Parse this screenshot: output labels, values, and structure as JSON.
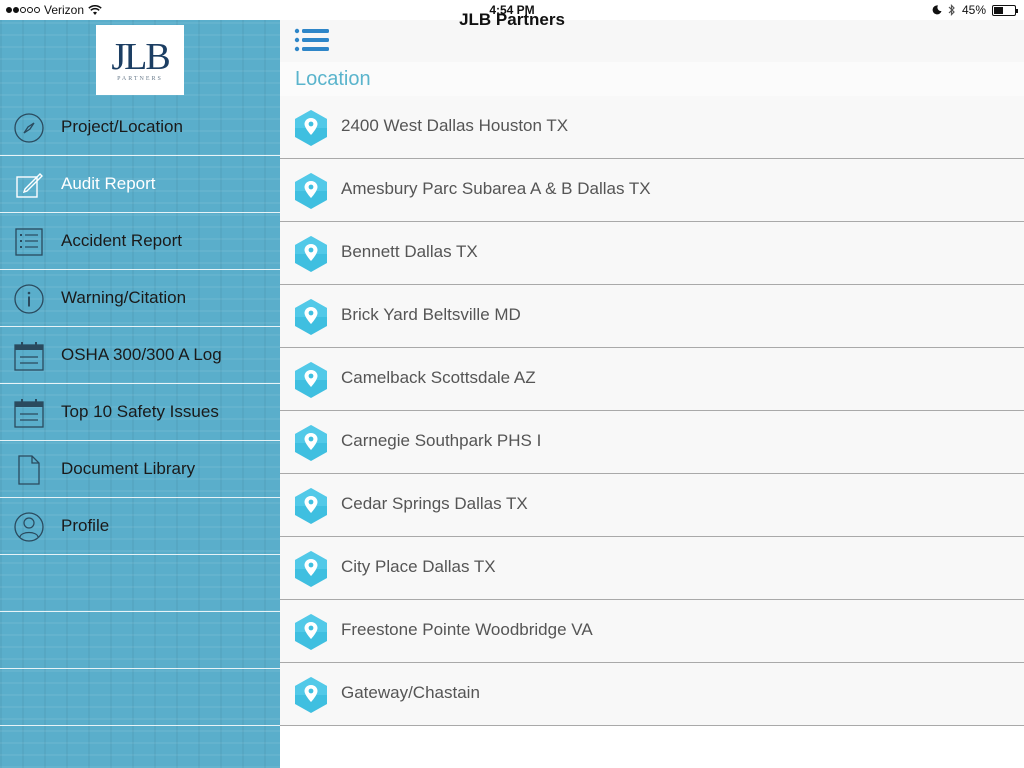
{
  "status_bar": {
    "carrier": "Verizon",
    "time": "4:54 PM",
    "battery": "45%",
    "battery_level": 0.45
  },
  "logo": {
    "text": "JLB",
    "subtext": "PARTNERS"
  },
  "sidebar": {
    "items": [
      {
        "label": "Project/Location",
        "icon": "compass-icon"
      },
      {
        "label": "Audit Report",
        "icon": "edit-icon"
      },
      {
        "label": "Accident Report",
        "icon": "list-icon"
      },
      {
        "label": "Warning/Citation",
        "icon": "info-icon"
      },
      {
        "label": "OSHA 300/300 A Log",
        "icon": "calendar-icon"
      },
      {
        "label": "Top 10 Safety Issues",
        "icon": "calendar-icon"
      },
      {
        "label": "Document Library",
        "icon": "document-icon"
      },
      {
        "label": "Profile",
        "icon": "user-icon"
      }
    ],
    "active_index": 1
  },
  "header": {
    "title": "JLB Partners"
  },
  "section": {
    "title": "Location"
  },
  "locations": [
    "2400 West Dallas Houston TX",
    "Amesbury Parc Subarea A & B Dallas TX",
    "Bennett Dallas TX",
    "Brick Yard Beltsville MD",
    "Camelback Scottsdale AZ",
    "Carnegie Southpark PHS I",
    "Cedar Springs Dallas TX",
    "City Place Dallas TX",
    "Freestone Pointe Woodbridge VA",
    "Gateway/Chastain"
  ],
  "colors": {
    "sidebar": "#5aaecb",
    "accent": "#5ab4cc",
    "pin": "#3fbfe0",
    "hamburger": "#2e86c8"
  }
}
